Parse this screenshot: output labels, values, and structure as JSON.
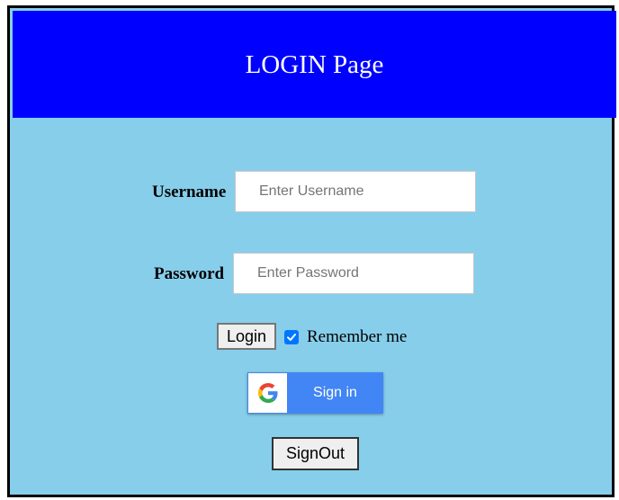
{
  "header": {
    "title": "LOGIN Page"
  },
  "form": {
    "username": {
      "label": "Username",
      "placeholder": "Enter Username",
      "value": ""
    },
    "password": {
      "label": "Password",
      "placeholder": "Enter Password",
      "value": ""
    },
    "login_label": "Login",
    "remember_label": "Remember me",
    "remember_checked": true
  },
  "google_signin": {
    "label": "Sign in",
    "icon": "google-g-icon"
  },
  "signout_label": "SignOut",
  "colors": {
    "header_bg": "#0000ff",
    "page_bg": "#87ceeb",
    "google_blue": "#4285f4",
    "checkbox_blue": "#0075ff"
  }
}
